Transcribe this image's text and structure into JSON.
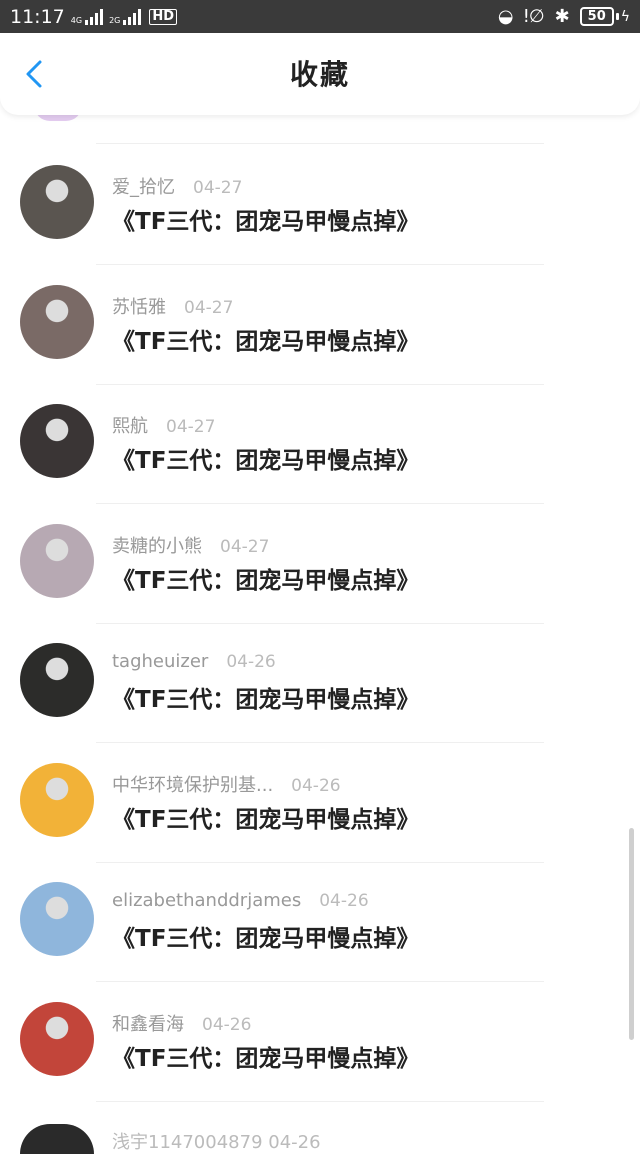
{
  "status_bar": {
    "time": "11:17",
    "net1": "4G",
    "net2": "2G",
    "hd": "HD",
    "battery": "50"
  },
  "header": {
    "title": "收藏",
    "back_icon": "chevron-left-icon"
  },
  "items": [
    {
      "name": "爱_拾忆",
      "date": "04-27",
      "title": "《TF三代：团宠马甲慢点掉》",
      "avatar_color": "#5a5550"
    },
    {
      "name": "苏恬雅",
      "date": "04-27",
      "title": "《TF三代：团宠马甲慢点掉》",
      "avatar_color": "#7a6a66"
    },
    {
      "name": "熙航",
      "date": "04-27",
      "title": "《TF三代：团宠马甲慢点掉》",
      "avatar_color": "#3a3535"
    },
    {
      "name": "卖糖的小熊",
      "date": "04-27",
      "title": "《TF三代：团宠马甲慢点掉》",
      "avatar_color": "#b7a9b3"
    },
    {
      "name": "tagheuizer",
      "date": "04-26",
      "title": "《TF三代：团宠马甲慢点掉》",
      "avatar_color": "#2c2c2a"
    },
    {
      "name": "中华环境保护别基...",
      "date": "04-26",
      "title": "《TF三代：团宠马甲慢点掉》",
      "avatar_color": "#f2b238"
    },
    {
      "name": "elizabethanddrjames",
      "date": "04-26",
      "title": "《TF三代：团宠马甲慢点掉》",
      "avatar_color": "#8fb6dc"
    },
    {
      "name": "和鑫看海",
      "date": "04-26",
      "title": "《TF三代：团宠马甲慢点掉》",
      "avatar_color": "#c2453a"
    }
  ],
  "bottom_partial_text": "浅宇1147004879  04-26",
  "colors": {
    "accent": "#2196f3",
    "status_bar": "#3a3a3a"
  }
}
